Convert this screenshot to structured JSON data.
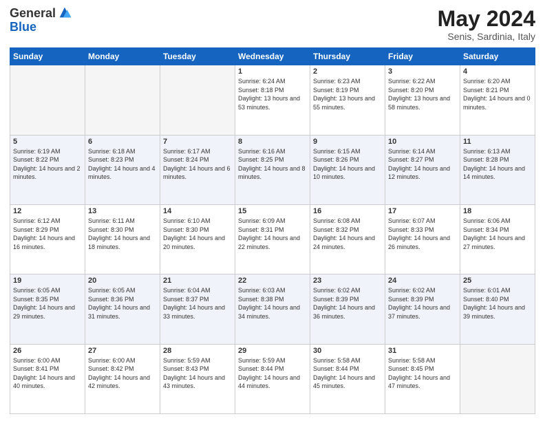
{
  "header": {
    "logo_general": "General",
    "logo_blue": "Blue",
    "month_title": "May 2024",
    "location": "Senis, Sardinia, Italy"
  },
  "days_of_week": [
    "Sunday",
    "Monday",
    "Tuesday",
    "Wednesday",
    "Thursday",
    "Friday",
    "Saturday"
  ],
  "weeks": [
    [
      {
        "day": "",
        "sunrise": "",
        "sunset": "",
        "daylight": ""
      },
      {
        "day": "",
        "sunrise": "",
        "sunset": "",
        "daylight": ""
      },
      {
        "day": "",
        "sunrise": "",
        "sunset": "",
        "daylight": ""
      },
      {
        "day": "1",
        "sunrise": "Sunrise: 6:24 AM",
        "sunset": "Sunset: 8:18 PM",
        "daylight": "Daylight: 13 hours and 53 minutes."
      },
      {
        "day": "2",
        "sunrise": "Sunrise: 6:23 AM",
        "sunset": "Sunset: 8:19 PM",
        "daylight": "Daylight: 13 hours and 55 minutes."
      },
      {
        "day": "3",
        "sunrise": "Sunrise: 6:22 AM",
        "sunset": "Sunset: 8:20 PM",
        "daylight": "Daylight: 13 hours and 58 minutes."
      },
      {
        "day": "4",
        "sunrise": "Sunrise: 6:20 AM",
        "sunset": "Sunset: 8:21 PM",
        "daylight": "Daylight: 14 hours and 0 minutes."
      }
    ],
    [
      {
        "day": "5",
        "sunrise": "Sunrise: 6:19 AM",
        "sunset": "Sunset: 8:22 PM",
        "daylight": "Daylight: 14 hours and 2 minutes."
      },
      {
        "day": "6",
        "sunrise": "Sunrise: 6:18 AM",
        "sunset": "Sunset: 8:23 PM",
        "daylight": "Daylight: 14 hours and 4 minutes."
      },
      {
        "day": "7",
        "sunrise": "Sunrise: 6:17 AM",
        "sunset": "Sunset: 8:24 PM",
        "daylight": "Daylight: 14 hours and 6 minutes."
      },
      {
        "day": "8",
        "sunrise": "Sunrise: 6:16 AM",
        "sunset": "Sunset: 8:25 PM",
        "daylight": "Daylight: 14 hours and 8 minutes."
      },
      {
        "day": "9",
        "sunrise": "Sunrise: 6:15 AM",
        "sunset": "Sunset: 8:26 PM",
        "daylight": "Daylight: 14 hours and 10 minutes."
      },
      {
        "day": "10",
        "sunrise": "Sunrise: 6:14 AM",
        "sunset": "Sunset: 8:27 PM",
        "daylight": "Daylight: 14 hours and 12 minutes."
      },
      {
        "day": "11",
        "sunrise": "Sunrise: 6:13 AM",
        "sunset": "Sunset: 8:28 PM",
        "daylight": "Daylight: 14 hours and 14 minutes."
      }
    ],
    [
      {
        "day": "12",
        "sunrise": "Sunrise: 6:12 AM",
        "sunset": "Sunset: 8:29 PM",
        "daylight": "Daylight: 14 hours and 16 minutes."
      },
      {
        "day": "13",
        "sunrise": "Sunrise: 6:11 AM",
        "sunset": "Sunset: 8:30 PM",
        "daylight": "Daylight: 14 hours and 18 minutes."
      },
      {
        "day": "14",
        "sunrise": "Sunrise: 6:10 AM",
        "sunset": "Sunset: 8:30 PM",
        "daylight": "Daylight: 14 hours and 20 minutes."
      },
      {
        "day": "15",
        "sunrise": "Sunrise: 6:09 AM",
        "sunset": "Sunset: 8:31 PM",
        "daylight": "Daylight: 14 hours and 22 minutes."
      },
      {
        "day": "16",
        "sunrise": "Sunrise: 6:08 AM",
        "sunset": "Sunset: 8:32 PM",
        "daylight": "Daylight: 14 hours and 24 minutes."
      },
      {
        "day": "17",
        "sunrise": "Sunrise: 6:07 AM",
        "sunset": "Sunset: 8:33 PM",
        "daylight": "Daylight: 14 hours and 26 minutes."
      },
      {
        "day": "18",
        "sunrise": "Sunrise: 6:06 AM",
        "sunset": "Sunset: 8:34 PM",
        "daylight": "Daylight: 14 hours and 27 minutes."
      }
    ],
    [
      {
        "day": "19",
        "sunrise": "Sunrise: 6:05 AM",
        "sunset": "Sunset: 8:35 PM",
        "daylight": "Daylight: 14 hours and 29 minutes."
      },
      {
        "day": "20",
        "sunrise": "Sunrise: 6:05 AM",
        "sunset": "Sunset: 8:36 PM",
        "daylight": "Daylight: 14 hours and 31 minutes."
      },
      {
        "day": "21",
        "sunrise": "Sunrise: 6:04 AM",
        "sunset": "Sunset: 8:37 PM",
        "daylight": "Daylight: 14 hours and 33 minutes."
      },
      {
        "day": "22",
        "sunrise": "Sunrise: 6:03 AM",
        "sunset": "Sunset: 8:38 PM",
        "daylight": "Daylight: 14 hours and 34 minutes."
      },
      {
        "day": "23",
        "sunrise": "Sunrise: 6:02 AM",
        "sunset": "Sunset: 8:39 PM",
        "daylight": "Daylight: 14 hours and 36 minutes."
      },
      {
        "day": "24",
        "sunrise": "Sunrise: 6:02 AM",
        "sunset": "Sunset: 8:39 PM",
        "daylight": "Daylight: 14 hours and 37 minutes."
      },
      {
        "day": "25",
        "sunrise": "Sunrise: 6:01 AM",
        "sunset": "Sunset: 8:40 PM",
        "daylight": "Daylight: 14 hours and 39 minutes."
      }
    ],
    [
      {
        "day": "26",
        "sunrise": "Sunrise: 6:00 AM",
        "sunset": "Sunset: 8:41 PM",
        "daylight": "Daylight: 14 hours and 40 minutes."
      },
      {
        "day": "27",
        "sunrise": "Sunrise: 6:00 AM",
        "sunset": "Sunset: 8:42 PM",
        "daylight": "Daylight: 14 hours and 42 minutes."
      },
      {
        "day": "28",
        "sunrise": "Sunrise: 5:59 AM",
        "sunset": "Sunset: 8:43 PM",
        "daylight": "Daylight: 14 hours and 43 minutes."
      },
      {
        "day": "29",
        "sunrise": "Sunrise: 5:59 AM",
        "sunset": "Sunset: 8:44 PM",
        "daylight": "Daylight: 14 hours and 44 minutes."
      },
      {
        "day": "30",
        "sunrise": "Sunrise: 5:58 AM",
        "sunset": "Sunset: 8:44 PM",
        "daylight": "Daylight: 14 hours and 45 minutes."
      },
      {
        "day": "31",
        "sunrise": "Sunrise: 5:58 AM",
        "sunset": "Sunset: 8:45 PM",
        "daylight": "Daylight: 14 hours and 47 minutes."
      },
      {
        "day": "",
        "sunrise": "",
        "sunset": "",
        "daylight": ""
      }
    ]
  ]
}
